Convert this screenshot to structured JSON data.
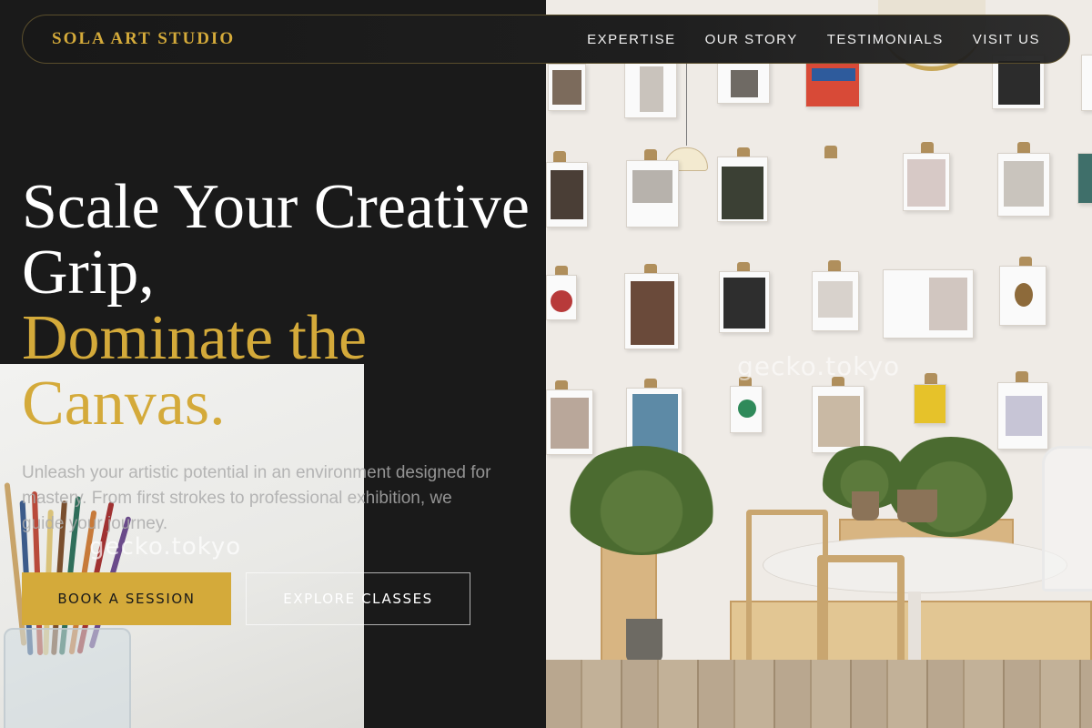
{
  "header": {
    "brand": "SOLA ART STUDIO",
    "nav": [
      "EXPERTISE",
      "OUR STORY",
      "TESTIMONIALS",
      "VISIT US"
    ]
  },
  "hero": {
    "headline_line1": "Scale Your Creative",
    "headline_line2": "Grip,",
    "headline_accent_line1": "Dominate the",
    "headline_accent_line2": "Canvas.",
    "subtext": "Unleash your artistic potential in an environment designed for mastery. From first strokes to professional exhibition, we guide your journey.",
    "primary_cta": "BOOK A SESSION",
    "secondary_cta": "EXPLORE CLASSES"
  },
  "photos": {
    "watermark": "gecko.tokyo",
    "watermark_brush": "gecko.tokyo"
  },
  "colors": {
    "background": "#1a1a1a",
    "accent_gold": "#d4aa3a",
    "text_white": "#ffffff"
  }
}
